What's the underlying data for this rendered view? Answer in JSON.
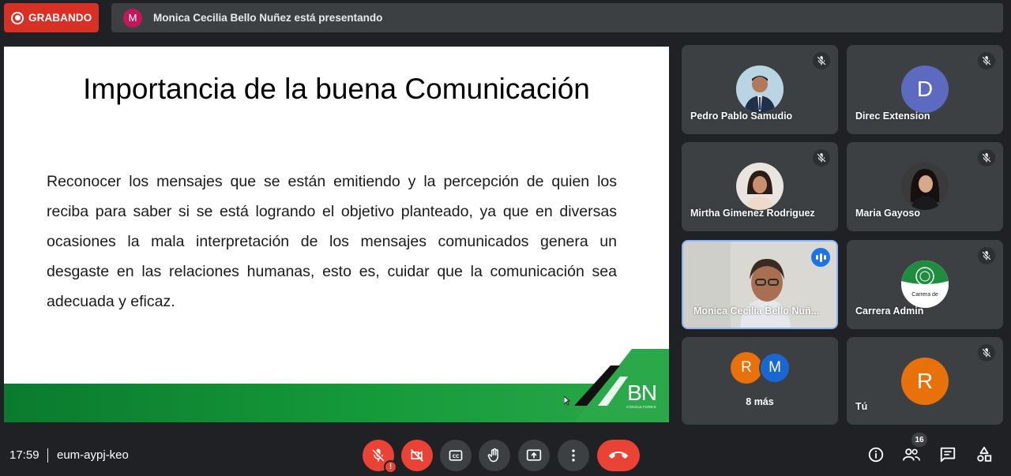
{
  "recording": {
    "label": "GRABANDO"
  },
  "presenting": {
    "avatar_letter": "M",
    "avatar_color": "#c2185b",
    "text": "Monica Cecilia Bello Nuñez está presentando"
  },
  "slide": {
    "title": "Importancia de la buena Comunicación",
    "body": "Reconocer los mensajes que se están emitiendo y la percepción de quien los reciba para saber si se está logrando el objetivo planteado, ya que en diversas ocasiones la mala interpretación de los mensajes comunicados genera un desgaste en las relaciones humanas, esto es, cuidar que la comunicación sea adecuada y eficaz.",
    "logo_text": "BN",
    "logo_subtext": "CONSULTORES"
  },
  "participants": [
    {
      "name": "Pedro Pablo Samudio",
      "muted": true,
      "avatar": "photo"
    },
    {
      "name": "Direc Extension",
      "muted": true,
      "avatar_letter": "D",
      "avatar_color": "#5c6bc0"
    },
    {
      "name": "Mirtha Gimenez Rodriguez",
      "muted": true,
      "avatar": "photo"
    },
    {
      "name": "Maria Gayoso",
      "muted": true,
      "avatar": "photo"
    },
    {
      "name": "Monica Cecilia Bello Nuñ...",
      "speaking": true,
      "avatar": "video"
    },
    {
      "name": "Carrera Admin",
      "muted": true,
      "avatar": "logo",
      "avatar_text": "Carrera de"
    },
    {
      "name": "",
      "overflow": true,
      "letters": [
        "R",
        "M"
      ],
      "label": "8 más"
    },
    {
      "name": "Tú",
      "muted": true,
      "avatar_letter": "R",
      "avatar_color": "#e8710a"
    }
  ],
  "bottom": {
    "time": "17:59",
    "meeting_code": "eum-aypj-keo",
    "people_count": "16",
    "controls": [
      "mic-off",
      "camera-off",
      "captions",
      "raise-hand",
      "present-screen",
      "more-options",
      "leave-call"
    ],
    "right_icons": [
      "info",
      "people",
      "chat",
      "activities"
    ]
  },
  "colors": {
    "accent_green": "#1e8e3e",
    "danger": "#ea4335",
    "tile": "#3c4043",
    "background": "#202124"
  }
}
